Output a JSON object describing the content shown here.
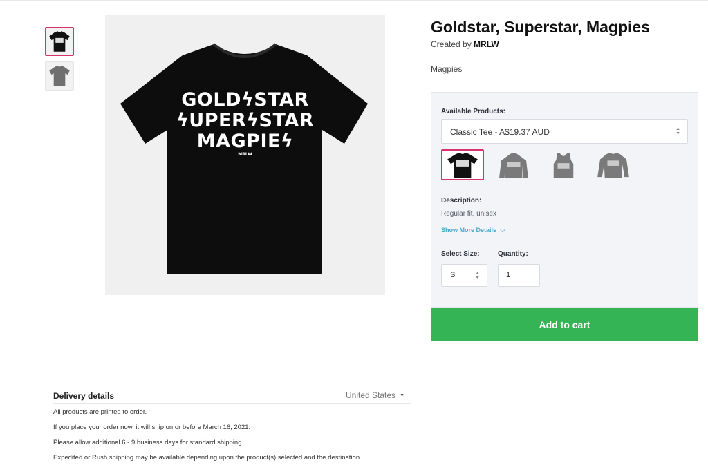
{
  "product": {
    "title": "Goldstar, Superstar, Magpies",
    "created_prefix": "Created by ",
    "creator": "MRLW",
    "subtitle": "Magpies",
    "print_lines": [
      "GOLDϟSTAR",
      "ϟUPERϟSTAR",
      "MAGPIEϟ"
    ],
    "print_brand": "MRLW"
  },
  "thumbnails": [
    {
      "name": "black-tee-front",
      "color": "#111111",
      "selected": true
    },
    {
      "name": "gray-tee",
      "color": "#6f6f6f",
      "selected": false
    }
  ],
  "options": {
    "available_label": "Available Products:",
    "product_selected": "Classic Tee - A$19.37 AUD",
    "styles": [
      {
        "name": "classic-tee",
        "color": "#111111",
        "selected": true
      },
      {
        "name": "hoodie",
        "color": "#7a7a7a",
        "selected": false
      },
      {
        "name": "tank-top",
        "color": "#7a7a7a",
        "selected": false
      },
      {
        "name": "long-sleeve",
        "color": "#7a7a7a",
        "selected": false
      }
    ],
    "description_label": "Description:",
    "description": "Regular fit, unisex",
    "show_more": "Show More Details",
    "size_label": "Select Size:",
    "size_value": "S",
    "quantity_label": "Quantity:",
    "quantity_value": "1"
  },
  "cart": {
    "label": "Add to cart",
    "color": "#34b454"
  },
  "delivery": {
    "title": "Delivery details",
    "country": "United States",
    "lines": [
      "All products are printed to order.",
      "If you place your order now, it will ship on or before March 16, 2021.",
      "Please allow additional 6 - 9 business days for standard shipping.",
      "Expedited or Rush shipping may be available depending upon the product(s) selected and the destination"
    ]
  },
  "colors": {
    "accent_selected": "#d6336c",
    "link": "#4aa8c8",
    "panel_bg": "#f3f4f8"
  }
}
